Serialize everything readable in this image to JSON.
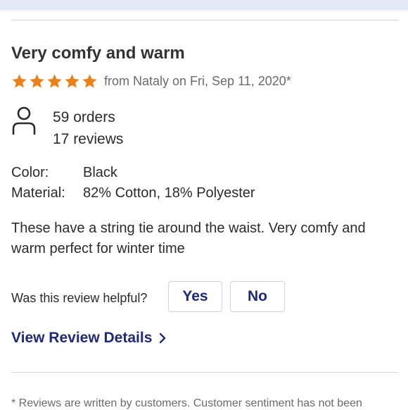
{
  "review": {
    "title": "Very comfy and warm",
    "rating": 5,
    "rating_max": 5,
    "byline": "from Nataly on Fri, Sep 11, 2020*",
    "author_stats": {
      "orders": "59 orders",
      "reviews": "17 reviews"
    },
    "attributes": [
      {
        "label": "Color:",
        "value": "Black"
      },
      {
        "label": "Material:",
        "value": "82% Cotton, 18% Polyester"
      }
    ],
    "body": "These have a string tie around the waist. Very comfy and warm perfect for winter time"
  },
  "helpful": {
    "question": "Was this review helpful?",
    "yes_label": "Yes",
    "no_label": "No"
  },
  "details_link": "View Review Details",
  "footnote": "* Reviews are written by customers. Customer sentiment has not been",
  "colors": {
    "star": "#e8821d",
    "link": "#1e2a78",
    "top_band": "#e4e9f7"
  },
  "icons": {
    "star": "star-icon",
    "user": "user-icon",
    "chevron": "chevron-right-icon"
  }
}
